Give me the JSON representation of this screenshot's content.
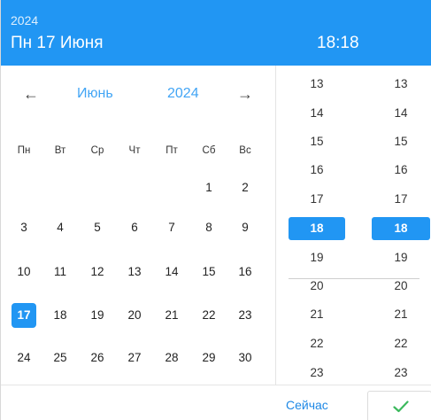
{
  "header": {
    "year": "2024",
    "date": "Пн 17 Июня",
    "time": "18:18"
  },
  "calendar": {
    "nav": {
      "prev": "←",
      "month": "Июнь",
      "year": "2024",
      "next": "→"
    },
    "weekdays": [
      "Пн",
      "Вт",
      "Ср",
      "Чт",
      "Пт",
      "Сб",
      "Вс"
    ],
    "weeks": [
      [
        "",
        "",
        "",
        "",
        "",
        "1",
        "2"
      ],
      [
        "3",
        "4",
        "5",
        "6",
        "7",
        "8",
        "9"
      ],
      [
        "10",
        "11",
        "12",
        "13",
        "14",
        "15",
        "16"
      ],
      [
        "17",
        "18",
        "19",
        "20",
        "21",
        "22",
        "23"
      ],
      [
        "24",
        "25",
        "26",
        "27",
        "28",
        "29",
        "30"
      ]
    ],
    "selected_day": "17"
  },
  "time": {
    "hours_visible": [
      "13",
      "14",
      "15",
      "16",
      "17",
      "18",
      "19",
      "20",
      "21",
      "22",
      "23"
    ],
    "minutes_visible": [
      "13",
      "14",
      "15",
      "16",
      "17",
      "18",
      "19",
      "20",
      "21",
      "22",
      "23"
    ],
    "selected_hour": "18",
    "selected_minute": "18"
  },
  "footer": {
    "now_label": "Сейчас"
  },
  "colors": {
    "accent": "#2196f3",
    "accent_text": "#42a5f5",
    "ok_check": "#3cb95d"
  },
  "icons": {
    "ok": "check-icon"
  }
}
